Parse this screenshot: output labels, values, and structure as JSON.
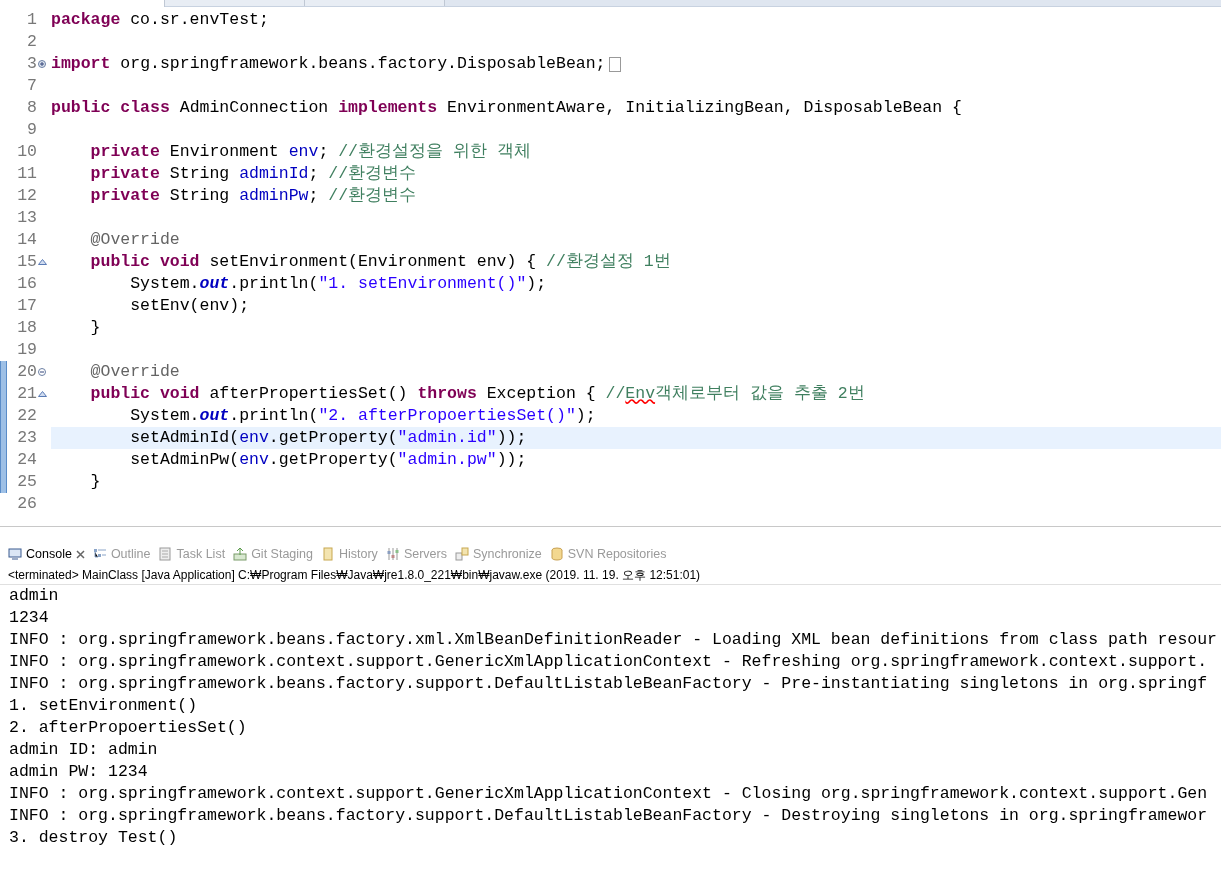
{
  "editor_tabs": [
    {
      "selected": true
    },
    {
      "selected": false
    },
    {
      "selected": false
    }
  ],
  "code_lines": [
    {
      "num": "1",
      "tokens": [
        {
          "kind": "keyword",
          "text": "package"
        },
        {
          "kind": "plain",
          "text": " co.sr.envTest;"
        }
      ]
    },
    {
      "num": "2"
    },
    {
      "num": "3",
      "kind": "expand",
      "folded": true,
      "tokens": [
        {
          "kind": "keyword",
          "text": "import"
        },
        {
          "kind": "plain",
          "text": " org.springframework.beans.factory.DisposableBean;"
        }
      ]
    },
    {
      "num": "7"
    },
    {
      "num": "8",
      "tokens": [
        {
          "kind": "keyword",
          "text": "public class"
        },
        {
          "kind": "plain",
          "text": " AdminConnection "
        },
        {
          "kind": "keyword",
          "text": "implements"
        },
        {
          "kind": "plain",
          "text": " EnvironmentAware, InitializingBean, DisposableBean {"
        }
      ]
    },
    {
      "num": "9"
    },
    {
      "num": "10",
      "tokens": [
        {
          "kind": "keyword",
          "text": "    private"
        },
        {
          "kind": "plain",
          "text": " Environment "
        },
        {
          "kind": "field",
          "text": "env"
        },
        {
          "kind": "plain",
          "text": "; "
        },
        {
          "kind": "comment",
          "text": "//환경설정을 위한 객체"
        }
      ]
    },
    {
      "num": "11",
      "tokens": [
        {
          "kind": "keyword",
          "text": "    private"
        },
        {
          "kind": "plain",
          "text": " String "
        },
        {
          "kind": "field",
          "text": "adminId"
        },
        {
          "kind": "plain",
          "text": "; "
        },
        {
          "kind": "comment",
          "text": "//환경변수"
        }
      ]
    },
    {
      "num": "12",
      "tokens": [
        {
          "kind": "keyword",
          "text": "    private"
        },
        {
          "kind": "plain",
          "text": " String "
        },
        {
          "kind": "field",
          "text": "adminPw"
        },
        {
          "kind": "plain",
          "text": "; "
        },
        {
          "kind": "comment",
          "text": "//환경변수"
        }
      ]
    },
    {
      "num": "13"
    },
    {
      "num": "14",
      "tokens": [
        {
          "kind": "annotation",
          "text": "    @Override"
        }
      ]
    },
    {
      "num": "15",
      "kind": "override",
      "tokens": [
        {
          "kind": "keyword",
          "text": "    public void"
        },
        {
          "kind": "plain",
          "text": " setEnvironment(Environment env) { "
        },
        {
          "kind": "comment",
          "text": "//환경설정 1번"
        }
      ]
    },
    {
      "num": "16",
      "tokens": [
        {
          "kind": "plain",
          "text": "        System."
        },
        {
          "kind": "static",
          "text": "out"
        },
        {
          "kind": "plain",
          "text": ".println("
        },
        {
          "kind": "string",
          "text": "\"1. setEnvironment()\""
        },
        {
          "kind": "plain",
          "text": ");"
        }
      ]
    },
    {
      "num": "17",
      "tokens": [
        {
          "kind": "plain",
          "text": "        setEnv(env);"
        }
      ]
    },
    {
      "num": "18",
      "tokens": [
        {
          "kind": "plain",
          "text": "    }"
        }
      ]
    },
    {
      "num": "19"
    },
    {
      "num": "20",
      "kind": "collapse",
      "ruler": true,
      "tokens": [
        {
          "kind": "annotation",
          "text": "    @Override"
        }
      ]
    },
    {
      "num": "21",
      "kind": "override",
      "ruler": true,
      "tokens": [
        {
          "kind": "keyword",
          "text": "    public void"
        },
        {
          "kind": "plain",
          "text": " afterPropertiesSet() "
        },
        {
          "kind": "keyword",
          "text": "throws"
        },
        {
          "kind": "plain",
          "text": " Exception { "
        },
        {
          "kind": "comment",
          "text": "//"
        },
        {
          "kind": "comment_misspelled",
          "text": "Env"
        },
        {
          "kind": "comment",
          "text": "객체로부터 값을 추출 2번"
        }
      ]
    },
    {
      "num": "22",
      "ruler": true,
      "tokens": [
        {
          "kind": "plain",
          "text": "        System."
        },
        {
          "kind": "static",
          "text": "out"
        },
        {
          "kind": "plain",
          "text": ".println("
        },
        {
          "kind": "string",
          "text": "\"2. afterPropoertiesSet()\""
        },
        {
          "kind": "plain",
          "text": ");"
        }
      ]
    },
    {
      "num": "23",
      "ruler": true,
      "current": true,
      "tokens": [
        {
          "kind": "plain",
          "text": "        setAdminId("
        },
        {
          "kind": "field",
          "text": "env"
        },
        {
          "kind": "plain",
          "text": ".getProperty("
        },
        {
          "kind": "string",
          "text": "\"admin.id\""
        },
        {
          "kind": "plain",
          "text": "));"
        }
      ]
    },
    {
      "num": "24",
      "ruler": true,
      "tokens": [
        {
          "kind": "plain",
          "text": "        setAdminPw("
        },
        {
          "kind": "field",
          "text": "env"
        },
        {
          "kind": "plain",
          "text": ".getProperty("
        },
        {
          "kind": "string",
          "text": "\"admin.pw\""
        },
        {
          "kind": "plain",
          "text": "));"
        }
      ]
    },
    {
      "num": "25",
      "ruler": true,
      "tokens": [
        {
          "kind": "plain",
          "text": "    }"
        }
      ]
    },
    {
      "num": "26"
    }
  ],
  "console_tabs": [
    {
      "label": "Console",
      "kind": "console",
      "selected": true
    },
    {
      "label": "Outline",
      "kind": "outline",
      "selected": false
    },
    {
      "label": "Task List",
      "kind": "tasks",
      "selected": false
    },
    {
      "label": "Git Staging",
      "kind": "git",
      "selected": false
    },
    {
      "label": "History",
      "kind": "history",
      "selected": false
    },
    {
      "label": "Servers",
      "kind": "servers",
      "selected": false
    },
    {
      "label": "Synchronize",
      "kind": "sync",
      "selected": false
    },
    {
      "label": "SVN Repositories",
      "kind": "svn",
      "selected": false
    }
  ],
  "console_status": "<terminated> MainClass [Java Application] C:₩Program Files₩Java₩jre1.8.0_221₩bin₩javaw.exe (2019. 11. 19. 오후 12:51:01)",
  "console_output": [
    "admin",
    "1234",
    "INFO : org.springframework.beans.factory.xml.XmlBeanDefinitionReader - Loading XML bean definitions from class path resour",
    "INFO : org.springframework.context.support.GenericXmlApplicationContext - Refreshing org.springframework.context.support.",
    "INFO : org.springframework.beans.factory.support.DefaultListableBeanFactory - Pre-instantiating singletons in org.springf",
    "1. setEnvironment()",
    "2. afterPropoertiesSet()",
    "admin ID: admin",
    "admin PW: 1234",
    "INFO : org.springframework.context.support.GenericXmlApplicationContext - Closing org.springframework.context.support.Gen",
    "INFO : org.springframework.beans.factory.support.DefaultListableBeanFactory - Destroying singletons in org.springframewor",
    "3. destroy Test()"
  ]
}
